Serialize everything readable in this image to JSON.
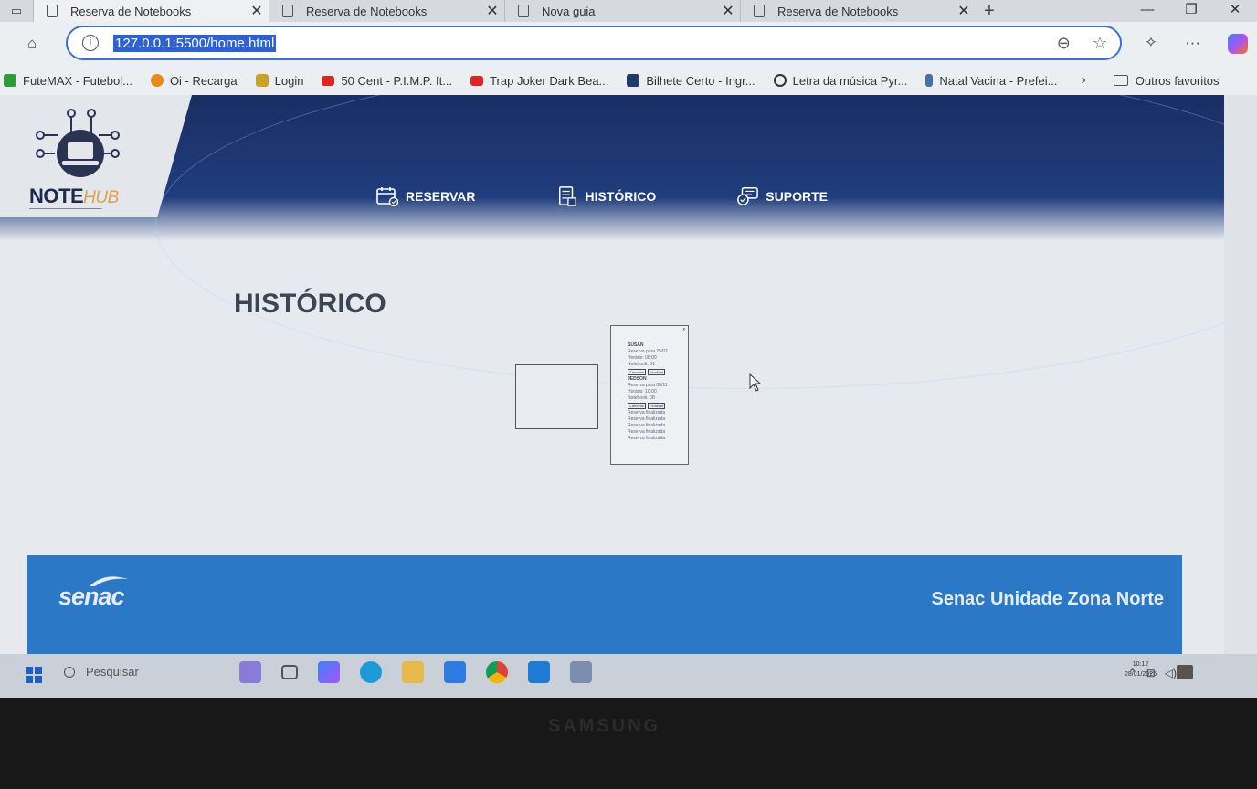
{
  "browser": {
    "tabs": [
      {
        "title": "Reserva de Notebooks",
        "active": true
      },
      {
        "title": "Reserva de Notebooks",
        "active": false
      },
      {
        "title": "Nova guia",
        "active": false
      },
      {
        "title": "Reserva de Notebooks",
        "active": false
      }
    ],
    "url": "127.0.0.1:5500/home.html",
    "favorites": [
      {
        "label": "FuteMAX - Futebol...",
        "color": "#2e9b3a"
      },
      {
        "label": "Oi - Recarga",
        "color": "#e88a1a"
      },
      {
        "label": "Login",
        "color": "#c9a227"
      },
      {
        "label": "50 Cent - P.I.M.P. ft...",
        "color": "#e02424"
      },
      {
        "label": "Trap Joker Dark Bea...",
        "color": "#e02424"
      },
      {
        "label": "Bilhete Certo - Ingr...",
        "color": "#1f3a6b"
      },
      {
        "label": "Letra da música Pyr...",
        "color": "#333333"
      },
      {
        "label": "Natal Vacina - Prefei...",
        "color": "#4a6fa5"
      }
    ],
    "favorites_more": "›",
    "other_favorites": "Outros favoritos"
  },
  "site": {
    "logo": {
      "main": "NOTE",
      "accent": "HUB"
    },
    "nav": [
      {
        "label": "RESERVAR",
        "icon": "calendar-icon"
      },
      {
        "label": "HISTÓRICO",
        "icon": "document-icon"
      },
      {
        "label": "SUPORTE",
        "icon": "chat-icon"
      }
    ],
    "page_title": "HISTÓRICO",
    "history_card": {
      "entries": [
        {
          "user": "SUSAN",
          "lines": [
            "Reserva para 25/07",
            "Horário: 08:00",
            "Notebook: 01"
          ],
          "buttons": [
            "Cancelar",
            "Finalizar"
          ]
        },
        {
          "user": "JEDSON",
          "lines": [
            "Reserva para 08/11",
            "Horário: 10:00",
            "Notebook: 08"
          ],
          "buttons": [
            "Cancelar",
            "Finalizar"
          ]
        }
      ],
      "extra_lines": [
        "Reserva finalizada",
        "Reserva finalizada",
        "Reserva finalizada",
        "Reserva finalizada",
        "Reserva finalizada"
      ],
      "close": "x"
    },
    "footer": {
      "brand": "senac",
      "unit": "Senac Unidade Zona Norte"
    }
  },
  "taskbar": {
    "search_placeholder": "Pesquisar",
    "time": "10:12",
    "date": "28/01/2025"
  },
  "monitor_brand": "SAMSUNG"
}
